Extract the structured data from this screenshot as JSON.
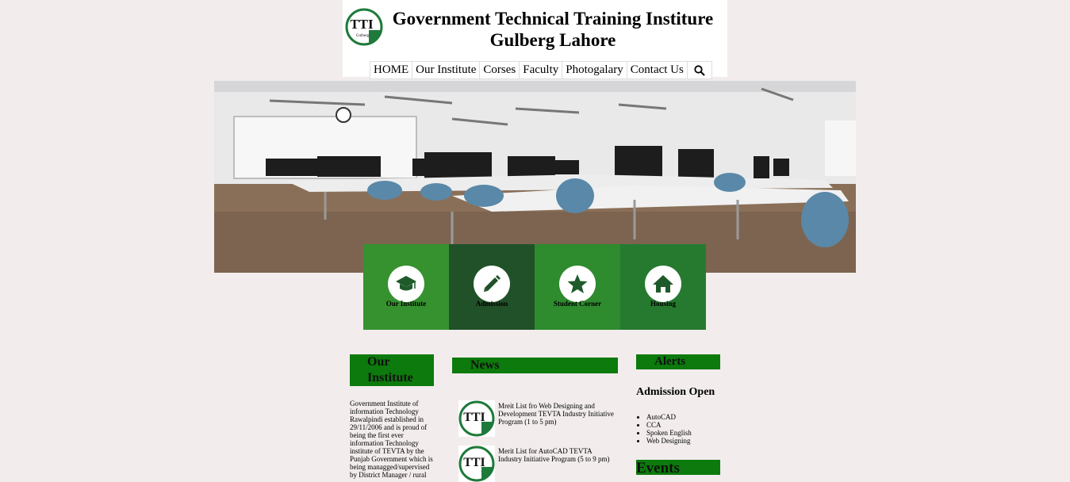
{
  "header": {
    "title_line1": "Government Technical Training Institure",
    "title_line2": "Gulberg Lahore",
    "logo_text": "TTI",
    "logo_subtext": "Gulberg"
  },
  "nav": {
    "items": [
      "HOME",
      "Our Institute",
      "Corses",
      "Faculty",
      "Photogalary",
      "Contact Us"
    ],
    "search_icon": "search-icon"
  },
  "tiles": [
    {
      "label": "Our Institute",
      "icon": "graduation-cap-icon",
      "color": "#36912f"
    },
    {
      "label": "Admission",
      "icon": "pencil-icon",
      "color": "#215128"
    },
    {
      "label": "Student Corner",
      "icon": "star-icon",
      "color": "#2e8b2e"
    },
    {
      "label": "Housing",
      "icon": "home-icon",
      "color": "#267a30"
    }
  ],
  "about": {
    "heading": "Our Institute",
    "text": "Government Institute of information Technology Rawalpindi established in 29/11/2006 and is proud of being the first ever information Technology institute of TEVTA by the Punjab Government which is being managged/supervised by District Manager / rural"
  },
  "news": {
    "heading": "News",
    "items": [
      "Mreit List fro Web Designing and Development TEVTA Industry Initiative Program (1 to 5 pm)",
      "Merit List for AutoCAD TEVTA Industry Initiative Program (5 to 9 pm)"
    ]
  },
  "alerts": {
    "heading": "Alerts",
    "subheading": "Admission Open",
    "items": [
      "AutoCAD",
      "CCA",
      "Spoken English",
      "Web Designing"
    ]
  },
  "events": {
    "heading": "Events"
  },
  "colors": {
    "page_bg": "#f2ecec",
    "heading_green": "#0c7a0c",
    "logo_green": "#1e7a3a"
  }
}
